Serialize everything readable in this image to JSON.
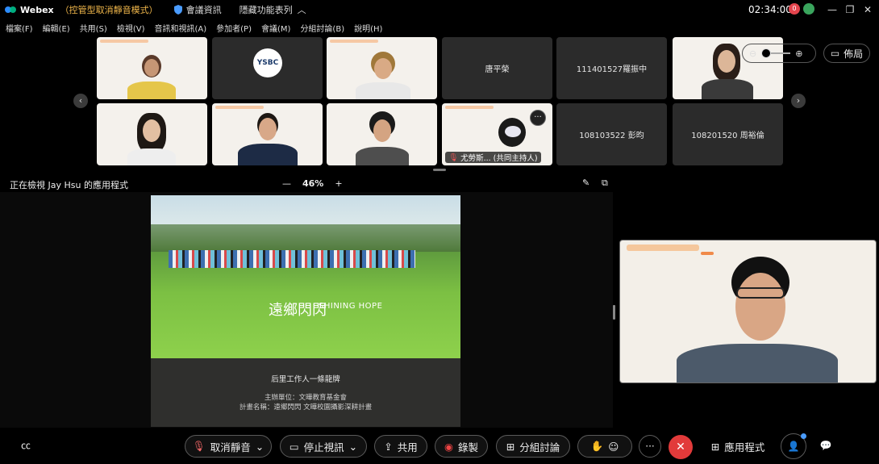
{
  "titlebar": {
    "app_name": "Webex",
    "mode": "（控管型取消靜音模式）",
    "meeting_info": "會議資訊",
    "hidden_toolbar": "隱藏功能表列",
    "time": "02:34:00",
    "rec_count": "0"
  },
  "menu": [
    "檔案(F)",
    "編輯(E)",
    "共用(S)",
    "檢視(V)",
    "音訊和視訊(A)",
    "參加者(P)",
    "會議(M)",
    "分組討論(B)",
    "說明(H)"
  ],
  "tiles": {
    "t4": "唐平榮",
    "t5": "111401527羅振中",
    "t11": "108103522 彭昀",
    "t12": "108201520 周裕倫",
    "t10_badge": "尤勞斯... (共同主持人)",
    "t2_logo": "YSBC"
  },
  "view_controls": {
    "layout_label": "佈局"
  },
  "share": {
    "title": "正在檢視 Jay Hsu 的應用程式",
    "zoom": "46%",
    "minus": "—",
    "plus": "+"
  },
  "slide": {
    "logo_cn": "遠鄉閃閃",
    "logo_en": "SHINING HOPE",
    "line1": "后里工作人一條龍牌",
    "line2": "主辦單位：文曄教育基金會",
    "line3": "計畫名稱：遠鄉閃閃  文曄校園攝影深耕計畫"
  },
  "toolbar": {
    "mute": "取消靜音",
    "stop_video": "停止視訊",
    "share": "共用",
    "record": "錄製",
    "breakout": "分組討論",
    "apps": "應用程式"
  }
}
